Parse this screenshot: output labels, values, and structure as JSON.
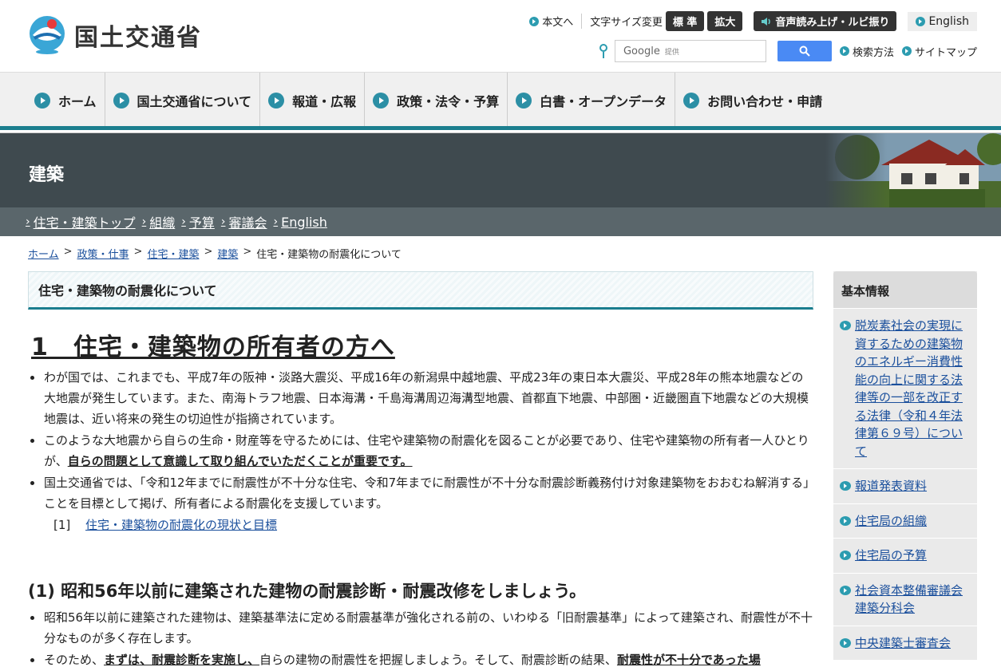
{
  "header": {
    "logo_text": "国土交通省",
    "skip_link": "本文へ",
    "font_size_label": "文字サイズ変更",
    "size_standard": "標 準",
    "size_large": "拡大",
    "tts_label": "音声読み上げ・ルビ振り",
    "english": "English",
    "search_placeholder": "Google",
    "search_provided": "提供",
    "search_help": "検索方法",
    "sitemap": "サイトマップ"
  },
  "gnav": [
    {
      "label": "ホーム"
    },
    {
      "label": "国土交通省について"
    },
    {
      "label": "報道・広報"
    },
    {
      "label": "政策・法令・予算"
    },
    {
      "label": "白書・オープンデータ"
    },
    {
      "label": "お問い合わせ・申請"
    }
  ],
  "banner": {
    "title": "建築"
  },
  "subnav": [
    {
      "label": "住宅・建築トップ"
    },
    {
      "label": "組織"
    },
    {
      "label": "予算"
    },
    {
      "label": "審議会"
    },
    {
      "label": "English"
    }
  ],
  "breadcrumb": {
    "items": [
      "ホーム",
      "政策・仕事",
      "住宅・建築",
      "建築"
    ],
    "current": "住宅・建築物の耐震化について",
    "sep": ">"
  },
  "main": {
    "section_title": "住宅・建築物の耐震化について",
    "h1": "1　住宅・建築物の所有者の方へ",
    "p1": "わが国では、これまでも、平成7年の阪神・淡路大震災、平成16年の新潟県中越地震、平成23年の東日本大震災、平成28年の熊本地震などの大地震が発生しています。また、南海トラフ地震、日本海溝・千島海溝周辺海溝型地震、首都直下地震、中部圏・近畿圏直下地震などの大規模地震は、近い将来の発生の切迫性が指摘されています。",
    "p2_a": "このような大地震から自らの生命・財産等を守るためには、住宅や建築物の耐震化を図ることが必要であり、住宅や建築物の所有者一人ひとりが、",
    "p2_em": "自らの問題として意識して取り組んでいただくことが重要です。",
    "p3": "国土交通省では、「令和12年までに耐震性が不十分な住宅、令和7年までに耐震性が不十分な耐震診断義務付け対象建築物をおおむね解消する」ことを目標として掲げ、所有者による耐震化を支援しています。",
    "link_num": "[1]",
    "link_label": "住宅・建築物の耐震化の現状と目標",
    "h2": "(1) 昭和56年以前に建築された建物の耐震診断・耐震改修をしましょう。",
    "p4": "昭和56年以前に建築された建物は、建築基準法に定める耐震基準が強化される前の、いわゆる「旧耐震基準」によって建築され、耐震性が不十分なものが多く存在します。",
    "p5_a": "そのため、",
    "p5_em": "まずは、耐震診断を実施し、",
    "p5_b": "自らの建物の耐震性を把握しましょう。そして、耐震診断の結果、",
    "p5_em2": "耐震性が不十分であった場"
  },
  "sidebar": {
    "title": "基本情報",
    "items": [
      {
        "label": "脱炭素社会の実現に資するための建築物のエネルギー消費性能の向上に関する法律等の一部を改正する法律（令和４年法律第６９号）について"
      },
      {
        "label": "報道発表資料"
      },
      {
        "label": "住宅局の組織"
      },
      {
        "label": "住宅局の予算"
      },
      {
        "label": "社会資本整備審議会建築分科会"
      },
      {
        "label": "中央建築士審査会"
      }
    ]
  }
}
